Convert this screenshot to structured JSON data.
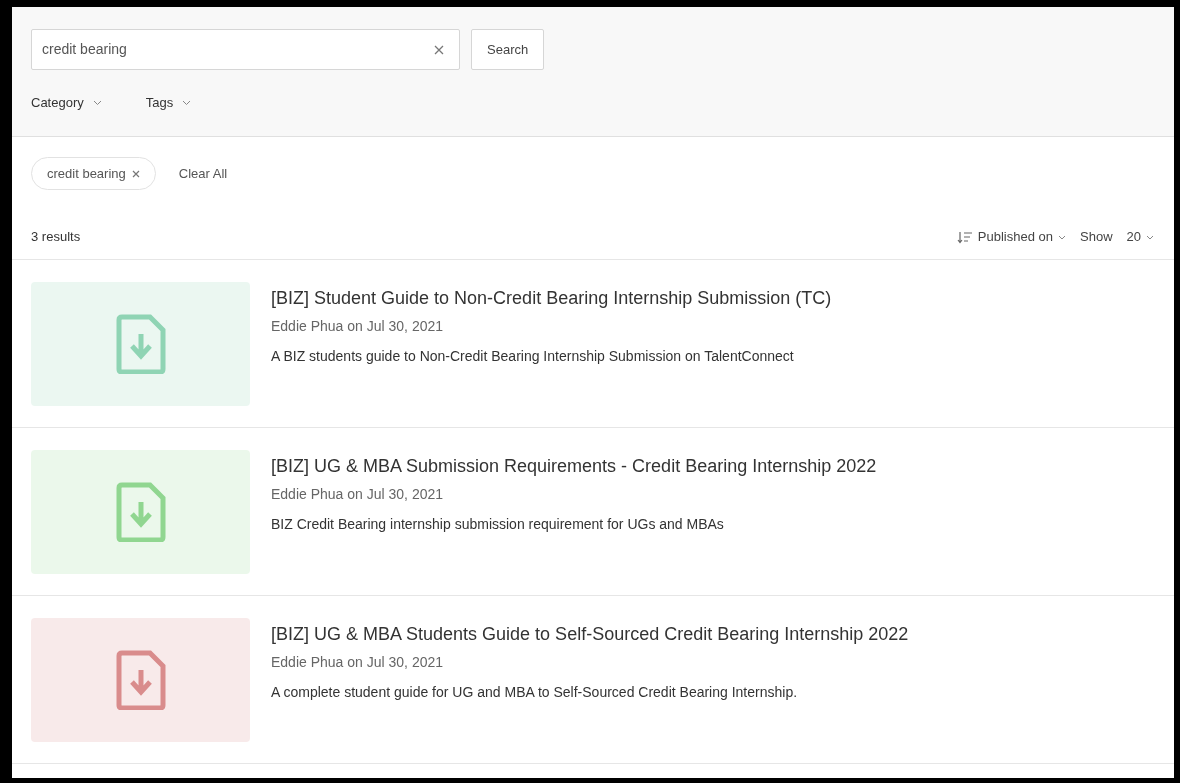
{
  "search": {
    "value": "credit bearing",
    "button": "Search"
  },
  "filters": [
    {
      "label": "Category"
    },
    {
      "label": "Tags"
    }
  ],
  "active_filters": {
    "chips": [
      {
        "label": "credit bearing"
      }
    ],
    "clear": "Clear All"
  },
  "results_count": "3 results",
  "sort": {
    "label": "Published on",
    "show_label": "Show",
    "show_value": "20"
  },
  "results": [
    {
      "title": "[BIZ] Student Guide to Non-Credit Bearing Internship Submission (TC)",
      "byline": "Eddie Phua on Jul 30, 2021",
      "description": "A BIZ students guide to Non-Credit Bearing Internship Submission on TalentConnect",
      "color": "#8fd4b4"
    },
    {
      "title": "[BIZ] UG & MBA Submission Requirements - Credit Bearing Internship 2022",
      "byline": "Eddie Phua on Jul 30, 2021",
      "description": "BIZ Credit Bearing internship submission requirement for UGs and MBAs",
      "color": "#90d690"
    },
    {
      "title": "[BIZ] UG & MBA Students Guide to Self-Sourced Credit Bearing Internship 2022",
      "byline": "Eddie Phua on Jul 30, 2021",
      "description": "A complete student guide for UG and MBA to Self-Sourced Credit Bearing Internship.",
      "color": "#d98c8c"
    }
  ]
}
